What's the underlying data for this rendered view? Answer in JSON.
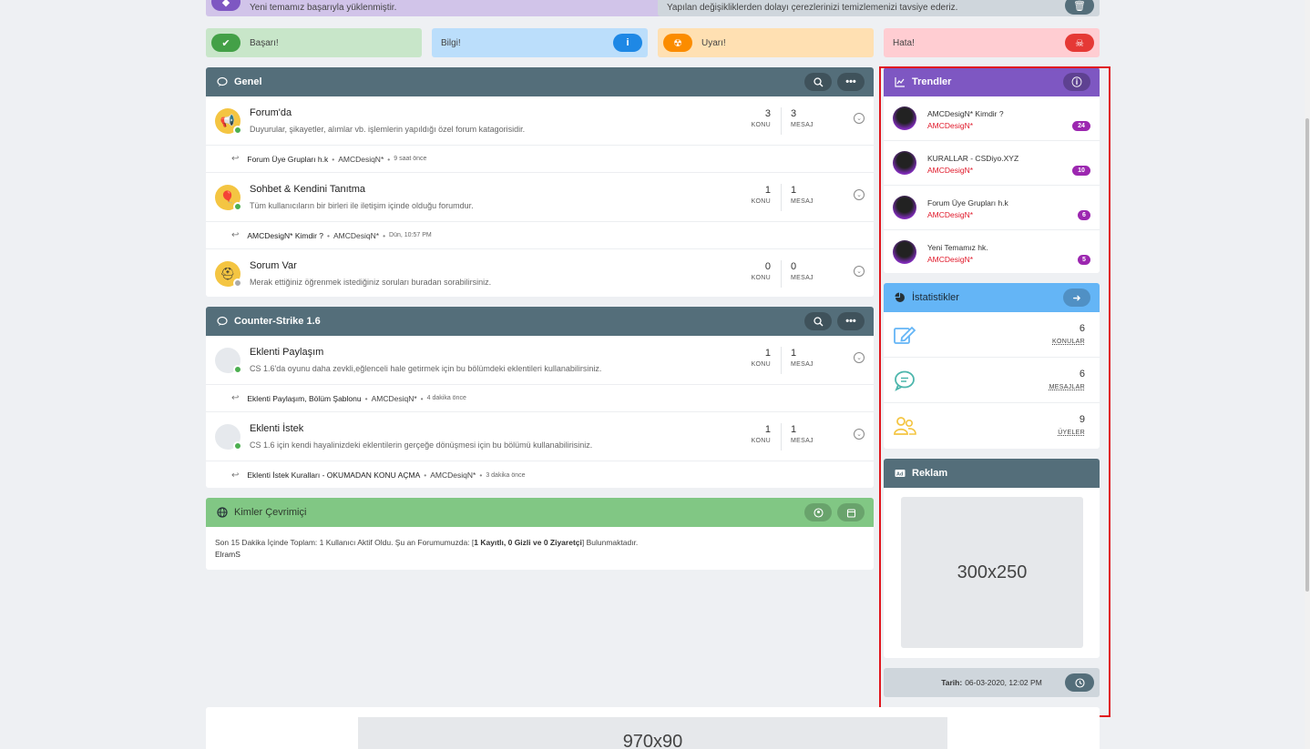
{
  "top_notices": {
    "success_upload": "Yeni temamız başarıyla yüklenmiştir.",
    "cookie_notice": "Yapılan değişikliklerden dolayı çerezlerinizi temizlemenizi tavsiye ederiz."
  },
  "alerts": {
    "success": "Başarı!",
    "info": "Bilgi!",
    "warning": "Uyarı!",
    "error": "Hata!"
  },
  "categories": [
    {
      "title": "Genel",
      "forums": [
        {
          "title": "Forum'da",
          "description": "Duyurular, şikayetler, alımlar vb. işlemlerin yapıldığı özel forum katagorisidir.",
          "topics": "3",
          "posts": "3",
          "last_title": "Forum Üye Grupları h.k",
          "last_user": "AMCDesiqN*",
          "last_time": "9 saat önce"
        },
        {
          "title": "Sohbet & Kendini Tanıtma",
          "description": "Tüm kullanıcıların bir birleri ile iletişim içinde olduğu forumdur.",
          "topics": "1",
          "posts": "1",
          "last_title": "AMCDesigN* Kimdir ?",
          "last_user": "AMCDesiqN*",
          "last_time": "Dün, 10:57 PM"
        },
        {
          "title": "Sorum Var",
          "description": "Merak ettiğiniz öğrenmek istediğiniz soruları buradan sorabilirsiniz.",
          "topics": "0",
          "posts": "0"
        }
      ]
    },
    {
      "title": "Counter-Strike 1.6",
      "forums": [
        {
          "title": "Eklenti Paylaşım",
          "description": "CS 1.6'da oyunu daha zevkli,eğlenceli hale getirmek için bu bölümdeki eklentileri kullanabilirsiniz.",
          "topics": "1",
          "posts": "1",
          "last_title": "Eklenti Paylaşım, Bölüm Şablonu",
          "last_user": "AMCDesiqN*",
          "last_time": "4 dakika önce"
        },
        {
          "title": "Eklenti İstek",
          "description": "CS 1.6 için kendi hayalinizdeki eklentilerin gerçeğe dönüşmesi için bu bölümü kullanabilirisiniz.",
          "topics": "1",
          "posts": "1",
          "last_title": "Eklenti İstek Kuralları - OKUMADAN KONU AÇMA",
          "last_user": "AMCDesiqN*",
          "last_time": "3 dakika önce"
        }
      ]
    }
  ],
  "labels": {
    "topics": "KONU",
    "posts": "MESAJ"
  },
  "online": {
    "title": "Kimler Çevrimiçi",
    "text_prefix": "Son 15 Dakika İçinde Toplam: 1 Kullanıcı Aktif Oldu. Şu an Forumumuzda: [",
    "text_bold": "1 Kayıtlı, 0 Gizli ve 0 Ziyaretçi",
    "text_suffix": "] Bulunmaktadır.",
    "users": "ElramS"
  },
  "trends": {
    "title": "Trendler",
    "items": [
      {
        "title": "AMCDesigN* Kimdir ?",
        "user": "AMCDesigN*",
        "count": "24"
      },
      {
        "title": "KURALLAR - CSDiyo.XYZ",
        "user": "AMCDesigN*",
        "count": "10"
      },
      {
        "title": "Forum Üye Grupları h.k",
        "user": "AMCDesigN*",
        "count": "6"
      },
      {
        "title": "Yeni Temamız hk.",
        "user": "AMCDesigN*",
        "count": "5"
      }
    ]
  },
  "stats": {
    "title": "İstatistikler",
    "items": [
      {
        "value": "6",
        "label": "KONULAR",
        "icon": "edit-icon",
        "color": "#64b5f6"
      },
      {
        "value": "6",
        "label": "MESAJLAR",
        "icon": "chat-icon",
        "color": "#4db6ac"
      },
      {
        "value": "9",
        "label": "ÜYELER",
        "icon": "users-icon",
        "color": "#f4c542"
      }
    ]
  },
  "ad": {
    "title": "Reklam",
    "placeholder": "300x250"
  },
  "date": {
    "label": "Tarih:",
    "value": "06-03-2020, 12:02 PM"
  },
  "bottom_ad": {
    "placeholder": "970x90"
  },
  "colors": {
    "category_header": "#546e7a",
    "online_header": "#81c784",
    "trends_header": "#7e57c2",
    "stats_header": "#64b5f6",
    "selection_box": "#e0161d"
  }
}
